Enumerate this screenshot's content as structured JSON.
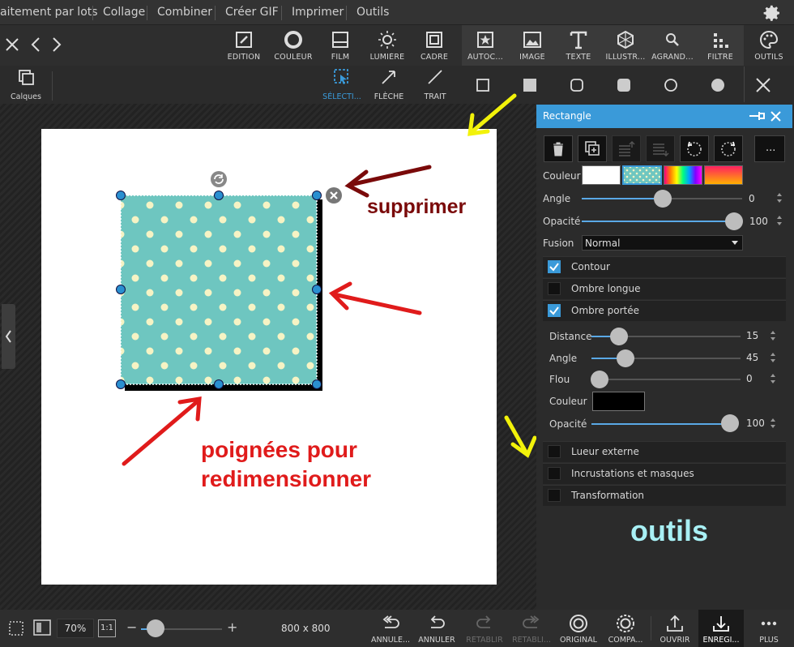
{
  "top_menu": {
    "items": [
      "aitement par lots",
      "Collage",
      "Combiner",
      "Créer GIF",
      "Imprimer",
      "Outils"
    ]
  },
  "toolbar": {
    "tools": [
      {
        "label": "EDITION",
        "icon": "edit-icon"
      },
      {
        "label": "COULEUR",
        "icon": "color-circle-icon"
      },
      {
        "label": "FILM",
        "icon": "film-icon"
      },
      {
        "label": "LUMIÈRE",
        "icon": "sun-icon"
      },
      {
        "label": "CADRE",
        "icon": "frame-icon"
      },
      {
        "label": "AUTOC...",
        "icon": "sticker-icon"
      },
      {
        "label": "IMAGE",
        "icon": "image-icon"
      },
      {
        "label": "TEXTE",
        "icon": "text-icon"
      },
      {
        "label": "ILLUSTR...",
        "icon": "illustration-icon"
      },
      {
        "label": "AGRAND...",
        "icon": "zoom-icon"
      },
      {
        "label": "FILTRE",
        "icon": "filter-icon"
      },
      {
        "label": "OUTILS",
        "icon": "palette-icon"
      }
    ]
  },
  "subbar": {
    "layers_label": "Calques",
    "select_label": "SÉLECTI...",
    "arrow_label": "FLÈCHE",
    "line_label": "TRAIT"
  },
  "panel": {
    "title": "Rectangle",
    "color_label": "Couleur",
    "angle_label": "Angle",
    "angle_value": "0",
    "opacity_label": "Opacité",
    "opacity_value": "100",
    "fusion_label": "Fusion",
    "fusion_value": "Normal",
    "more_label": "...",
    "options": [
      {
        "label": "Contour",
        "checked": true
      },
      {
        "label": "Ombre longue",
        "checked": false
      },
      {
        "label": "Ombre portée",
        "checked": true
      }
    ],
    "shadow": {
      "distance_label": "Distance",
      "distance_value": "15",
      "angle_label": "Angle",
      "angle_value": "45",
      "blur_label": "Flou",
      "blur_value": "0",
      "color_label": "Couleur",
      "opacity_label": "Opacité",
      "opacity_value": "100"
    },
    "more_options": [
      {
        "label": "Lueur externe",
        "checked": false
      },
      {
        "label": "Incrustations et masques",
        "checked": false
      },
      {
        "label": "Transformation",
        "checked": false
      }
    ]
  },
  "annotations": {
    "delete": "supprimer",
    "handles_line1": "poignées pour",
    "handles_line2": "redimensionner",
    "tools": "outils"
  },
  "bottom": {
    "zoom": "70%",
    "ratio": "1:1",
    "size": "800 x 800",
    "buttons": [
      {
        "label": "ANNULE...",
        "icon": "undo-all-icon",
        "enabled": true
      },
      {
        "label": "ANNULER",
        "icon": "undo-icon",
        "enabled": true
      },
      {
        "label": "RÉTABLIR",
        "icon": "redo-icon",
        "enabled": false
      },
      {
        "label": "RÉTABLI...",
        "icon": "redo-all-icon",
        "enabled": false
      },
      {
        "label": "ORIGINAL",
        "icon": "original-icon",
        "enabled": true
      },
      {
        "label": "COMPA...",
        "icon": "compare-icon",
        "enabled": true
      },
      {
        "label": "OUVRIR",
        "icon": "open-icon",
        "enabled": true
      },
      {
        "label": "ENREGI...",
        "icon": "save-icon",
        "enabled": true
      },
      {
        "label": "PLUS",
        "icon": "more-icon",
        "enabled": true
      }
    ]
  },
  "colors": {
    "accent": "#3a9ad9",
    "shape_fill": "#6ec6c0",
    "dots": "#f6f3c4",
    "annotation_red": "#e01b1b",
    "annotation_darkred": "#7a0a0a",
    "annotation_yellow": "#f2f20a",
    "annotation_cyan": "#a8f0f5"
  }
}
